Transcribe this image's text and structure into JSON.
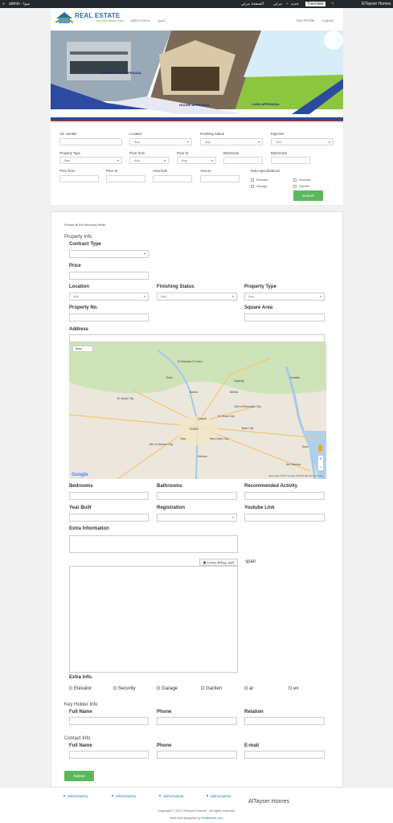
{
  "admin_bar": {
    "site": "admin - سوا",
    "items": [
      "الصفحة مرئي",
      "مرئي",
      "جديد"
    ],
    "translate": "Translate",
    "user": "ElTayser Homes"
  },
  "header": {
    "logo_text": "REAL ESTATE",
    "logo_sub": "Your best dream home",
    "nav": [
      "Add a menu",
      "اتصل"
    ],
    "your_profile": "Your Profile",
    "logout": "Logout"
  },
  "banner": {
    "labels": [
      "COMMERCIAL APPRAISAL",
      "HOUSE APPRAISAL",
      "LAND APPRAISAL"
    ]
  },
  "search": {
    "ad_number": "Ad. number",
    "location": "Location",
    "location_value": "Any",
    "finishing_status": "Finishing Status",
    "finishing_value": "Any",
    "payment": "Payment",
    "payment_value": "Sell",
    "property_type": "Property Type",
    "property_type_value": "Any",
    "floor_from": "Floor from",
    "floor_from_value": "Any",
    "floor_to": "Floor to",
    "floor_to_value": "Any",
    "bedrooms": "Bedrooms",
    "bathrooms": "Bathrooms",
    "price_from": "Price from",
    "price_to": "Price to",
    "area_from": "Area from",
    "area_to": "Area to",
    "extra_spec": "Extra specifications",
    "extras": [
      "Elevator",
      "Security",
      "Garage",
      "Garden"
    ],
    "search_button": "Search"
  },
  "form": {
    "note": "Please fill the following fields:",
    "property_info": "Property Info",
    "contract_type": "Contract Type",
    "price": "Price",
    "location": "Location",
    "location_value": "Any",
    "finishing_status": "Finishing Status",
    "finishing_value": "Any",
    "property_type": "Property Type",
    "property_type_value": "Any",
    "property_no": "Property No.",
    "square_area": "Square Area",
    "address": "Address",
    "bedrooms": "Bedrooms",
    "bathrooms": "Bathrooms",
    "recommended": "Recommended Activity",
    "year_built": "Year Built",
    "registration": "Registration",
    "youtube": "Youtube Link",
    "extra_information": "Extra Information",
    "add_media": "اضف وسائط متعددة",
    "span": "span",
    "extra_info": "Extra Info.",
    "extra_opts": [
      "Elevator",
      "Security",
      "Garage",
      "Garden",
      "ar",
      "en"
    ],
    "key_holder": "Key Holder Info",
    "full_name": "Full Name",
    "phone": "Phone",
    "relation": "Relation",
    "contact_info": "Contact Info",
    "email": "E-mail",
    "submit": "Submit"
  },
  "map": {
    "type": "Map",
    "google": "Google",
    "credit": "Map data ©2017 Google ORION-ME   Terms of Use",
    "labels": [
      "Cairo",
      "Giza",
      "Helwan",
      "Qalyub",
      "Banha",
      "Tanta",
      "Zagazig",
      "Ismailia",
      "Suez",
      "10th of Ramadan City",
      "El Obour City",
      "New Cairo City",
      "6th of October City",
      "El Mahalla El Kubra",
      "El Sadat City",
      "Bilbeis",
      "Ain Sokhna",
      "Badr City"
    ]
  },
  "footer": {
    "links": [
      "add-property",
      "add-property",
      "add-property",
      "add-property"
    ],
    "brand": "AlTayser Homes",
    "copyright": "Copyright © 2017 AlTayser Homes . All rights reserved.",
    "built_by": "Built and designed by",
    "built_link": "ReaMedia.com"
  },
  "colors": {
    "admin_bar": "#23282d",
    "brand_blue": "#2d6aa1",
    "banner_blue": "#2b4aa0",
    "button_green": "#5cb85c",
    "link": "#3b73b9"
  }
}
